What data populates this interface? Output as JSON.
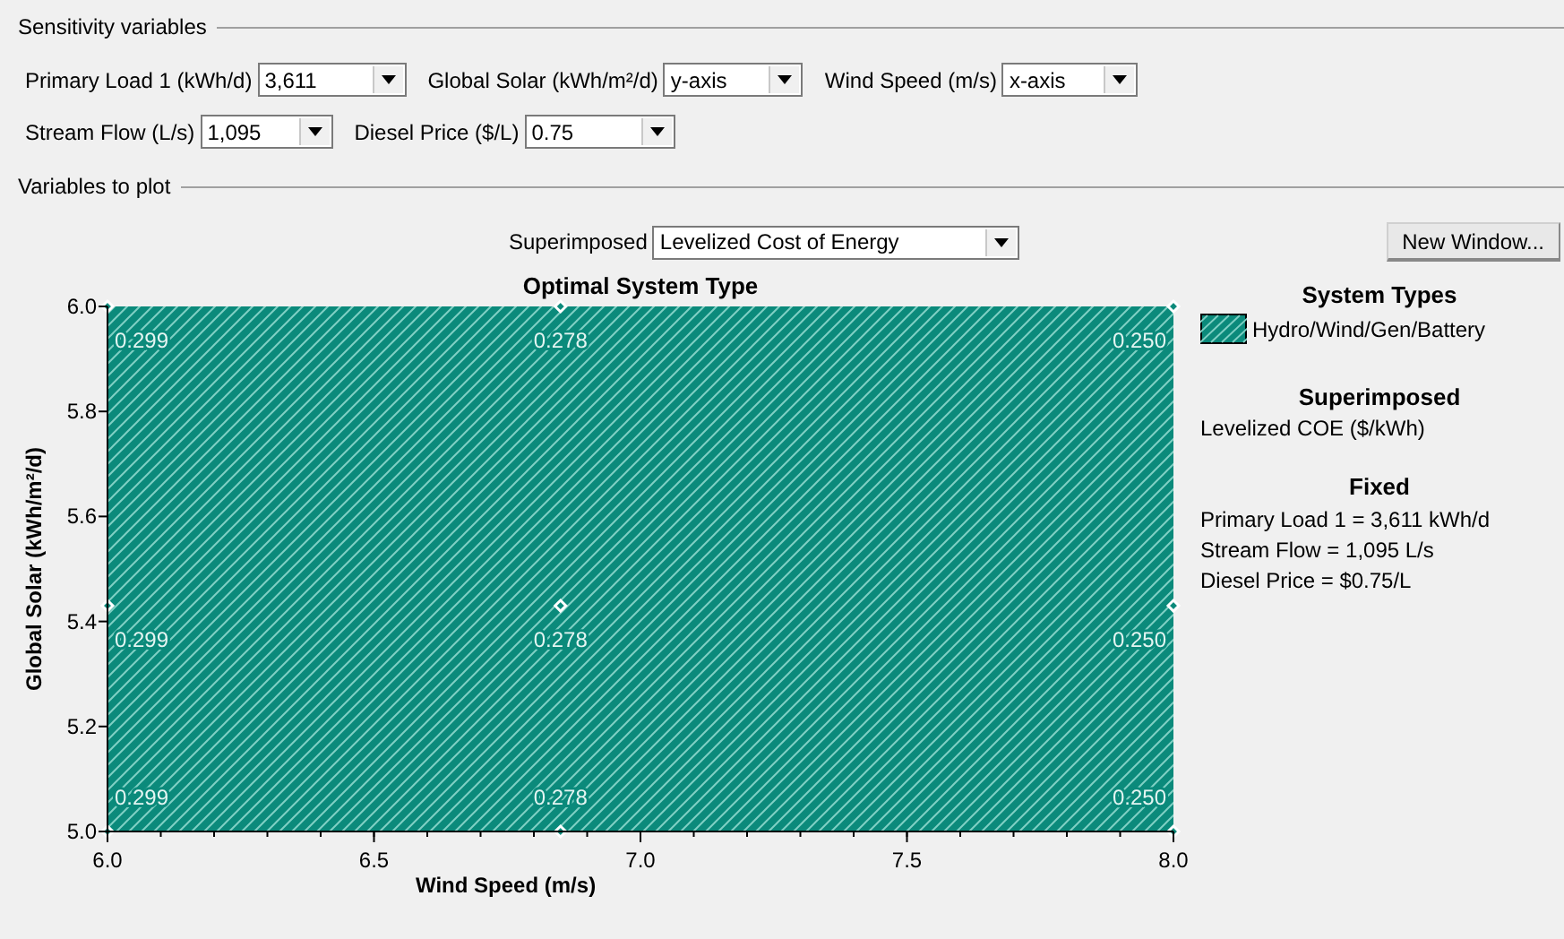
{
  "sensitivity_variables": {
    "title": "Sensitivity variables",
    "rows": [
      [
        {
          "label": "Primary Load 1 (kWh/d)",
          "value": "3,611"
        },
        {
          "label": "Global Solar (kWh/m²/d)",
          "value": "y-axis"
        },
        {
          "label": "Wind Speed (m/s)",
          "value": "x-axis"
        }
      ],
      [
        {
          "label": "Stream Flow (L/s)",
          "value": "1,095"
        },
        {
          "label": "Diesel Price ($/L)",
          "value": "0.75"
        }
      ]
    ]
  },
  "variables_to_plot": {
    "title": "Variables to plot",
    "superimposed": {
      "label": "Superimposed",
      "value": "Levelized Cost of Energy"
    },
    "new_window_button": "New Window..."
  },
  "chart_data": {
    "type": "scatter",
    "title": "Optimal System Type",
    "xlabel": "Wind Speed (m/s)",
    "ylabel": "Global Solar (kWh/m²/d)",
    "xlim": [
      6,
      8
    ],
    "ylim": [
      5,
      6
    ],
    "xticks": [
      {
        "value": 6,
        "label": "6.0"
      },
      {
        "value": 6.5,
        "label": "6.5"
      },
      {
        "value": 7,
        "label": "7.0"
      },
      {
        "value": 7.5,
        "label": "7.5"
      },
      {
        "value": 8,
        "label": "8.0"
      }
    ],
    "yticks": [
      {
        "value": 5,
        "label": "5.0"
      },
      {
        "value": 5.2,
        "label": "5.2"
      },
      {
        "value": 5.4,
        "label": "5.4"
      },
      {
        "value": 5.6,
        "label": "5.6"
      },
      {
        "value": 5.8,
        "label": "5.8"
      },
      {
        "value": 6,
        "label": "6.0"
      }
    ],
    "x": [
      6,
      6,
      6,
      6.85,
      6.85,
      6.85,
      8,
      8,
      8
    ],
    "series": [
      {
        "name": "Hydro/Wind/Gen/Battery",
        "color": "#0b8a7b",
        "values": [
          6,
          5.43,
          5,
          6,
          5.43,
          5,
          6,
          5.43,
          5
        ]
      }
    ],
    "value_labels": [
      "0.299",
      "0.299",
      "0.299",
      "0.278",
      "0.278",
      "0.278",
      "0.250",
      "0.250",
      "0.250"
    ]
  },
  "legend": {
    "system_types_title": "System Types",
    "superimposed_title": "Superimposed",
    "superimposed_value": "Levelized COE ($/kWh)",
    "fixed_title": "Fixed",
    "fixed": [
      "Primary Load 1 = 3,611 kWh/d",
      "Stream Flow = 1,095 L/s",
      "Diesel Price = $0.75/L"
    ]
  }
}
